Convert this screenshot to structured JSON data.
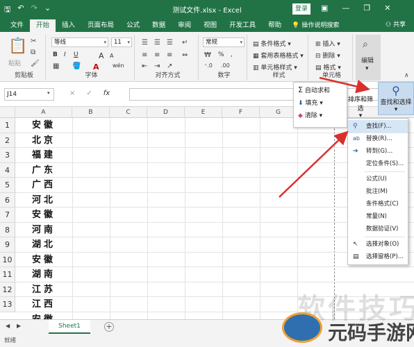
{
  "titlebar": {
    "title": "测试文件.xlsx - Excel",
    "login": "登录",
    "qat_icons": [
      "save-icon",
      "undo-icon",
      "redo-icon",
      "customize-icon"
    ],
    "window_controls": [
      "ribbon-display-icon",
      "minimize-icon",
      "restore-icon",
      "close-icon"
    ]
  },
  "tabs": {
    "items": [
      "文件",
      "开始",
      "插入",
      "页面布局",
      "公式",
      "数据",
      "审阅",
      "视图",
      "开发工具",
      "帮助"
    ],
    "active": "开始",
    "search": "操作说明搜索",
    "share": "共享"
  },
  "ribbon": {
    "clipboard": {
      "label": "剪贴板",
      "paste": "粘贴"
    },
    "font": {
      "label": "字体",
      "name": "等线",
      "size": "11",
      "bold": "B",
      "italic": "I",
      "underline": "U",
      "grow": "A",
      "shrink": "A",
      "color_letter": "A",
      "wen": "wén"
    },
    "alignment": {
      "label": "对齐方式"
    },
    "number": {
      "label": "数字",
      "format": "常规",
      "percent": "%",
      "comma": ","
    },
    "styles": {
      "label": "样式",
      "conditional": "条件格式",
      "table": "套用表格格式",
      "cell": "单元格样式"
    },
    "cells": {
      "label": "单元格",
      "insert": "插入",
      "delete": "删除",
      "format": "格式"
    },
    "editing": {
      "label": "编辑"
    }
  },
  "formula_bar": {
    "name_box": "J14",
    "cancel": "×",
    "enter": "✓",
    "fx": "fx",
    "value": ""
  },
  "editing_panel": {
    "autosum": "自动求和",
    "fill": "填充",
    "clear": "清除",
    "sort_filter": "排序和筛选",
    "find_select": "查找和选择"
  },
  "find_menu": {
    "items": [
      {
        "label": "查找(F)...",
        "icon": "search-icon",
        "highlight": true
      },
      {
        "label": "替换(R)...",
        "icon": "replace-icon"
      },
      {
        "label": "转到(G)...",
        "icon": "arrow-right-icon"
      },
      {
        "label": "定位条件(S)...",
        "icon": ""
      },
      {
        "label": "公式(U)",
        "icon": ""
      },
      {
        "label": "批注(M)",
        "icon": ""
      },
      {
        "label": "条件格式(C)",
        "icon": ""
      },
      {
        "label": "常量(N)",
        "icon": ""
      },
      {
        "label": "数据验证(V)",
        "icon": ""
      },
      {
        "label": "选择对象(O)",
        "icon": "cursor-icon"
      },
      {
        "label": "选择窗格(P)...",
        "icon": "pane-icon"
      }
    ]
  },
  "grid": {
    "columns": [
      "A",
      "B",
      "C",
      "D",
      "E",
      "F",
      "G"
    ],
    "rows": [
      "1",
      "2",
      "3",
      "4",
      "5",
      "6",
      "7",
      "8",
      "9",
      "10",
      "11",
      "12",
      "13"
    ],
    "colA": [
      "安徽",
      "北京",
      "福建",
      "广东",
      "广西",
      "河北",
      "安徽",
      "河南",
      "湖北",
      "安徽",
      "湖南",
      "江苏",
      "江西",
      "安徽"
    ]
  },
  "sheets": {
    "active": "Sheet1",
    "add": "+"
  },
  "status": {
    "ready": "就绪"
  },
  "watermark": {
    "text": "软件技巧",
    "site": "元码手游网"
  },
  "colors": {
    "excel_green": "#217346",
    "arrow_red": "#d9302c",
    "menu_highlight": "#d6e6f5"
  }
}
